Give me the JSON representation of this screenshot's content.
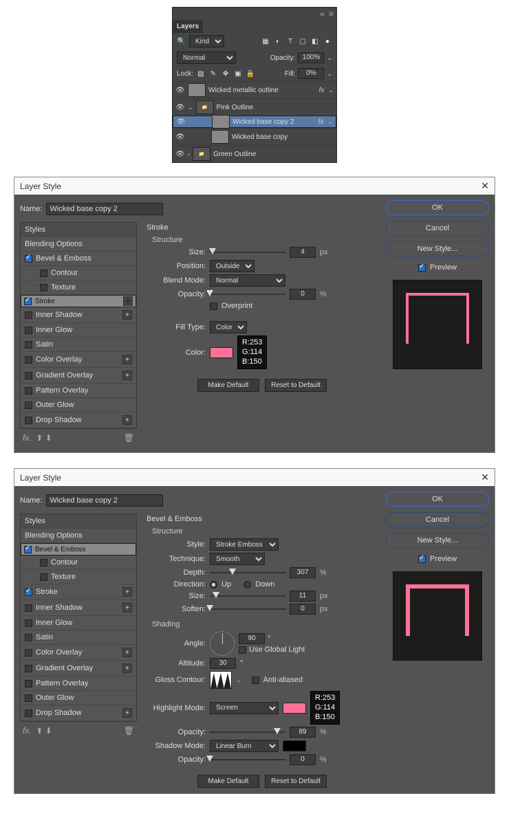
{
  "colors": {
    "pink": "#fd7296",
    "black": "#000000"
  },
  "layersPanel": {
    "title": "Layers",
    "filterLabel": "Kind",
    "blendMode": "Normal",
    "opacityLabel": "Opacity:",
    "opacityValue": "100%",
    "lockLabel": "Lock:",
    "fillLabel": "Fill:",
    "fillValue": "0%",
    "layers": [
      {
        "name": "Wicked metallic outline",
        "fx": true,
        "indent": 0,
        "thumb": "img"
      },
      {
        "name": "Pink Outline",
        "fx": false,
        "indent": 0,
        "thumb": "folder",
        "expand": "open"
      },
      {
        "name": "Wicked base copy 2",
        "fx": true,
        "indent": 2,
        "thumb": "img",
        "selected": true
      },
      {
        "name": "Wicked base copy",
        "fx": false,
        "indent": 2,
        "thumb": "img"
      },
      {
        "name": "Green Outline",
        "fx": false,
        "indent": 0,
        "thumb": "folder",
        "expand": "closed"
      }
    ]
  },
  "dialog1": {
    "title": "Layer Style",
    "nameLabel": "Name:",
    "nameValue": "Wicked base copy 2",
    "stylesHeader": "Styles",
    "blendingOptions": "Blending Options",
    "effects": [
      {
        "label": "Bevel & Emboss",
        "checked": true,
        "plus": false
      },
      {
        "label": "Contour",
        "checked": false,
        "plus": false,
        "sub": true
      },
      {
        "label": "Texture",
        "checked": false,
        "plus": false,
        "sub": true
      },
      {
        "label": "Stroke",
        "checked": true,
        "plus": true,
        "selected": true
      },
      {
        "label": "Inner Shadow",
        "checked": false,
        "plus": true
      },
      {
        "label": "Inner Glow",
        "checked": false,
        "plus": false
      },
      {
        "label": "Satin",
        "checked": false,
        "plus": false
      },
      {
        "label": "Color Overlay",
        "checked": false,
        "plus": true
      },
      {
        "label": "Gradient Overlay",
        "checked": false,
        "plus": true
      },
      {
        "label": "Pattern Overlay",
        "checked": false,
        "plus": false
      },
      {
        "label": "Outer Glow",
        "checked": false,
        "plus": false
      },
      {
        "label": "Drop Shadow",
        "checked": false,
        "plus": true
      }
    ],
    "center": {
      "title": "Stroke",
      "structureTitle": "Structure",
      "sizeLabel": "Size:",
      "sizeValue": "4",
      "sizeUnit": "px",
      "positionLabel": "Position:",
      "positionValue": "Outside",
      "blendModeLabel": "Blend Mode:",
      "blendModeValue": "Normal",
      "opacityLabel": "Opacity:",
      "opacityValue": "0",
      "opacityUnit": "%",
      "overprintLabel": "Overprint",
      "fillTypeLabel": "Fill Type:",
      "fillTypeValue": "Color",
      "colorLabel": "Color:",
      "rgb": {
        "r": "R:253",
        "g": "G:114",
        "b": "B:150"
      },
      "makeDefault": "Make Default",
      "resetDefault": "Reset to Default"
    },
    "right": {
      "ok": "OK",
      "cancel": "Cancel",
      "newStyle": "New Style...",
      "previewLabel": "Preview"
    }
  },
  "dialog2": {
    "title": "Layer Style",
    "nameLabel": "Name:",
    "nameValue": "Wicked base copy 2",
    "stylesHeader": "Styles",
    "blendingOptions": "Blending Options",
    "effects": [
      {
        "label": "Bevel & Emboss",
        "checked": true,
        "plus": false,
        "selected": true
      },
      {
        "label": "Contour",
        "checked": false,
        "plus": false,
        "sub": true
      },
      {
        "label": "Texture",
        "checked": false,
        "plus": false,
        "sub": true
      },
      {
        "label": "Stroke",
        "checked": true,
        "plus": true
      },
      {
        "label": "Inner Shadow",
        "checked": false,
        "plus": true
      },
      {
        "label": "Inner Glow",
        "checked": false,
        "plus": false
      },
      {
        "label": "Satin",
        "checked": false,
        "plus": false
      },
      {
        "label": "Color Overlay",
        "checked": false,
        "plus": true
      },
      {
        "label": "Gradient Overlay",
        "checked": false,
        "plus": true
      },
      {
        "label": "Pattern Overlay",
        "checked": false,
        "plus": false
      },
      {
        "label": "Outer Glow",
        "checked": false,
        "plus": false
      },
      {
        "label": "Drop Shadow",
        "checked": false,
        "plus": true
      }
    ],
    "center": {
      "title": "Bevel & Emboss",
      "structureTitle": "Structure",
      "styleLabel": "Style:",
      "styleValue": "Stroke Emboss",
      "techniqueLabel": "Technique:",
      "techniqueValue": "Smooth",
      "depthLabel": "Depth:",
      "depthValue": "307",
      "depthUnit": "%",
      "directionLabel": "Direction:",
      "upLabel": "Up",
      "downLabel": "Down",
      "sizeLabel": "Size:",
      "sizeValue": "11",
      "sizeUnit": "px",
      "softenLabel": "Soften:",
      "softenValue": "0",
      "softenUnit": "px",
      "shadingTitle": "Shading",
      "angleLabel": "Angle:",
      "angleValue": "90",
      "globalLightLabel": "Use Global Light",
      "altitudeLabel": "Altitude:",
      "altitudeValue": "30",
      "glossContourLabel": "Gloss Contour:",
      "antiAliasedLabel": "Anti-aliased",
      "highlightModeLabel": "Highlight Mode:",
      "highlightModeValue": "Screen",
      "highlightOpacityLabel": "Opacity:",
      "highlightOpacityValue": "89",
      "opUnit": "%",
      "shadowModeLabel": "Shadow Mode:",
      "shadowModeValue": "Linear Burn",
      "shadowOpacityLabel": "Opacity:",
      "shadowOpacityValue": "0",
      "rgb": {
        "r": "R:253",
        "g": "G:114",
        "b": "B:150"
      },
      "makeDefault": "Make Default",
      "resetDefault": "Reset to Default"
    },
    "right": {
      "ok": "OK",
      "cancel": "Cancel",
      "newStyle": "New Style...",
      "previewLabel": "Preview"
    }
  }
}
